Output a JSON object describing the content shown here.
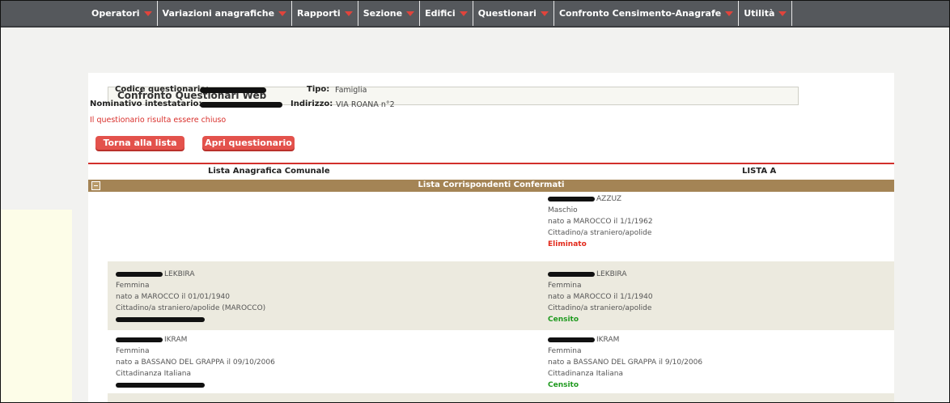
{
  "menu": [
    {
      "label": "Operatori"
    },
    {
      "label": "Variazioni anagrafiche"
    },
    {
      "label": "Rapporti"
    },
    {
      "label": "Sezione"
    },
    {
      "label": "Edifici"
    },
    {
      "label": "Questionari"
    },
    {
      "label": "Confronto Censimento-Anagrafe"
    },
    {
      "label": "Utilità"
    }
  ],
  "form": {
    "title": "Confronto Questionari Web",
    "codice_label": "Codice questionario:",
    "nominativo_label": "Nominativo intestatario:",
    "tipo_label": "Tipo:",
    "tipo_value": "Famiglia",
    "indirizzo_label": "Indirizzo:",
    "indirizzo_value": "VIA ROANA n°2",
    "warning": "Il questionario risulta essere chiuso",
    "btn_back": "Torna alla lista",
    "btn_open": "Apri questionario"
  },
  "columns": {
    "left": "Lista Anagrafica Comunale",
    "right": "LISTA A"
  },
  "section": {
    "title": "Lista Corrispondenti Confermati"
  },
  "rows": [
    {
      "left": null,
      "right": {
        "surname": "AZZUZ",
        "gender": "Maschio",
        "birth": "nato a MAROCCO il 1/1/1962",
        "citizenship": "Cittadino/a straniero/apolide",
        "status": "Eliminato"
      }
    },
    {
      "left": {
        "surname": "LEKBIRA",
        "gender": "Femmina",
        "birth": "nato a MAROCCO il 01/01/1940",
        "citizenship": "Cittadino/a straniero/apolide (MAROCCO)"
      },
      "right": {
        "surname": "LEKBIRA",
        "gender": "Femmina",
        "birth": "nato a MAROCCO il 1/1/1940",
        "citizenship": "Cittadino/a straniero/apolide",
        "status": "Censito"
      }
    },
    {
      "left": {
        "surname": "IKRAM",
        "gender": "Femmina",
        "birth": "nato a BASSANO DEL GRAPPA il 09/10/2006",
        "citizenship": "Cittadinanza Italiana"
      },
      "right": {
        "surname": "IKRAM",
        "gender": "Femmina",
        "birth": "nato a BASSANO DEL GRAPPA il 9/10/2006",
        "citizenship": "Cittadinanza Italiana",
        "status": "Censito"
      }
    }
  ]
}
